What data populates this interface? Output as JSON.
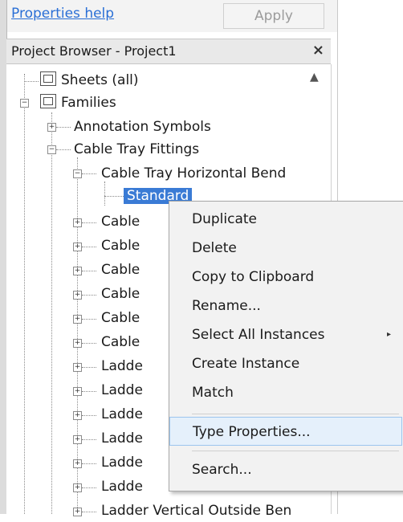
{
  "top": {
    "properties_help": "Properties help",
    "apply_label": "Apply"
  },
  "project_browser": {
    "title": "Project Browser - Project1",
    "close_glyph": "×",
    "tree": {
      "sheets": "Sheets (all)",
      "families": "Families",
      "annotation_symbols": "Annotation Symbols",
      "cable_tray_fittings": "Cable Tray Fittings",
      "cable_tray_horizontal_bend": "Cable Tray Horizontal Bend",
      "standard": "Standard",
      "partial_items": [
        "Cable",
        "Cable",
        "Cable",
        "Cable",
        "Cable",
        "Cable",
        "Ladde",
        "Ladde",
        "Ladde",
        "Ladde",
        "Ladde",
        "Ladde"
      ],
      "last_item": "Ladder Vertical Outside Ben"
    }
  },
  "context_menu": {
    "items": [
      "Duplicate",
      "Delete",
      "Copy to Clipboard",
      "Rename...",
      "Select All Instances",
      "Create Instance",
      "Match",
      "Type Properties...",
      "Search..."
    ],
    "submenu_arrow": "▸",
    "hover_color": "#e5f0fb"
  }
}
